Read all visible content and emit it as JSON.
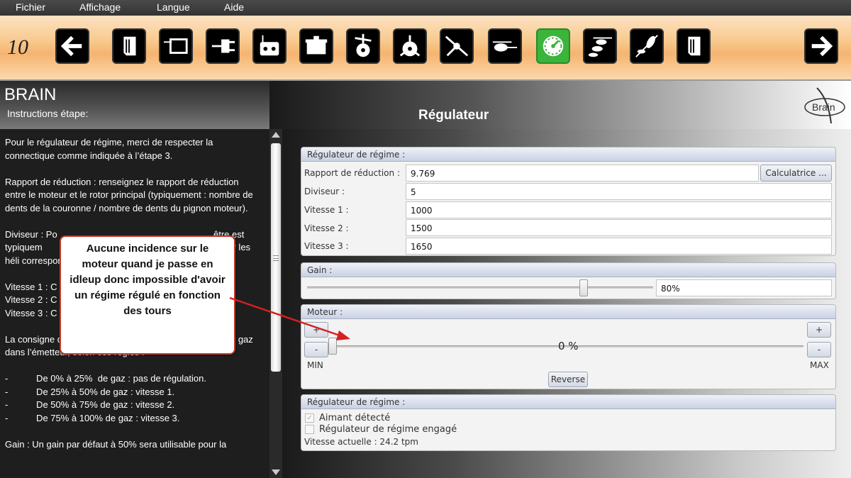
{
  "menu": {
    "items": [
      "Fichier",
      "Affichage",
      "Langue",
      "Aide"
    ]
  },
  "toolbar": {
    "step_number": "10",
    "active_color": "#3bb43b",
    "icons": [
      "back-arrow-icon",
      "manual-icon",
      "frame-icon",
      "plug-icon",
      "radio-icon",
      "box-icon",
      "rotor-head-icon",
      "swashplate-icon",
      "tail-rotor-icon",
      "helicopter-side-icon",
      "gauge-icon",
      "helicopter-flight-icon",
      "helicopter-tilt-icon",
      "manual-end-icon",
      "forward-arrow-icon"
    ]
  },
  "header": {
    "app_name": "BRAIN",
    "instructions_label": "Instructions étape:",
    "step_title": "Régulateur",
    "logo_text": "Brain"
  },
  "instructions": {
    "text": "Pour le régulateur de régime, merci de respecter la connectique comme indiquée à l’étape 3.\n\nRapport de réduction : renseignez le rapport de réduction entre le moteur et le rotor principal (typiquement : nombre de dents de la couronne / nombre de dents du pignon moteur).\n\nDiviseur : Po                                                             être est typiquem                                                              ne. Pour les héli correspondr                                                           ur.\n\nVitesse 1 : C\nVitesse 2 : C\nVitesse 3 : C\n\nLa consigne de vitesse est sélectionnée via la courbe de gaz dans l’émetteur, selon ces règles :\n\n-           De 0% à 25%  de gaz : pas de régulation.\n-           De 25% à 50% de gaz : vitesse 1.\n-           De 50% à 75% de gaz : vitesse 2.\n-           De 75% à 100% de gaz : vitesse 3.\n\nGain : Un gain par défaut à 50% sera utilisable pour la"
  },
  "callout": {
    "text": "Aucune incidence sur le moteur quand je passe en idleup donc impossible d'avoir un régime régulé en fonction des tours"
  },
  "governor": {
    "header": "Régulateur de régime :",
    "ratio_label": "Rapport de réduction :",
    "ratio_value": "9.769",
    "calc_button": "Calculatrice ...",
    "divider_label": "Diviseur :",
    "divider_value": "5",
    "speed1_label": "Vitesse 1 :",
    "speed1_value": "1000",
    "speed2_label": "Vitesse 2 :",
    "speed2_value": "1500",
    "speed3_label": "Vitesse 3 :",
    "speed3_value": "1650"
  },
  "gain": {
    "header": "Gain :",
    "value": "80%",
    "level": 0.8
  },
  "motor": {
    "header": "Moteur :",
    "plus": "+",
    "minus": "-",
    "value": "0 %",
    "level": 0.0,
    "min_label": "MIN",
    "max_label": "MAX",
    "reverse_button": "Reverse"
  },
  "status": {
    "header": "Régulateur de régime :",
    "magnet_label": "Aimant détecté",
    "magnet_checked": true,
    "engaged_label": "Régulateur de régime engagé",
    "engaged_checked": false,
    "current_speed": "Vitesse actuelle : 24.2 tpm"
  }
}
